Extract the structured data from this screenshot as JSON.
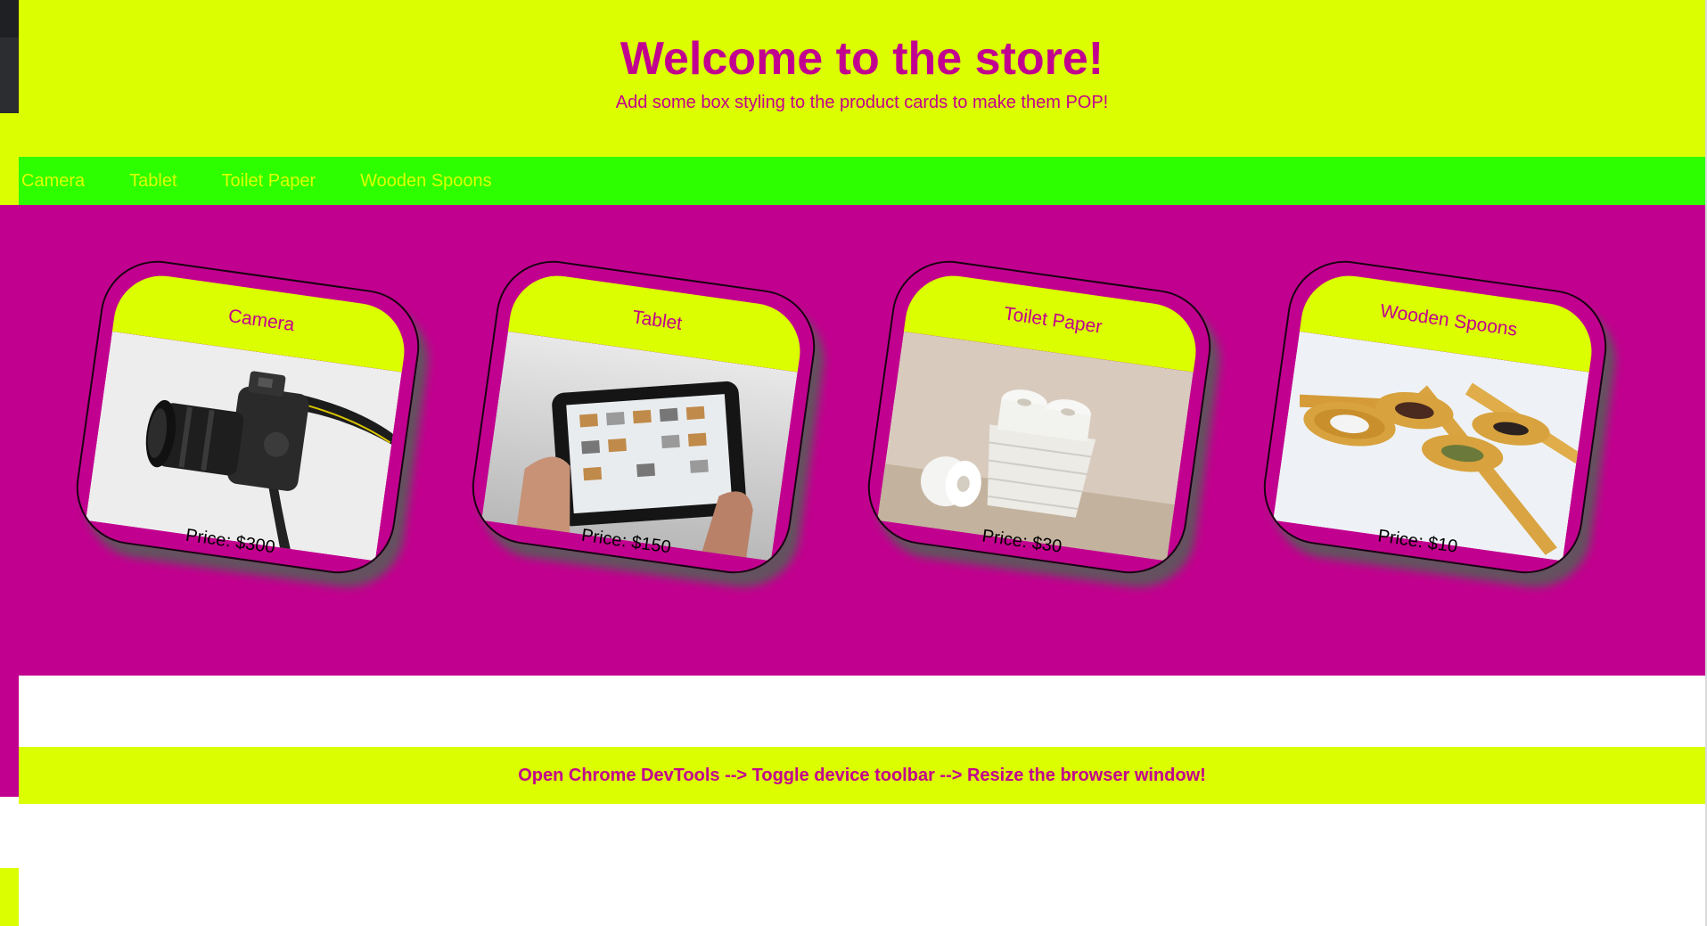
{
  "header": {
    "title": "Welcome to the store!",
    "subtitle": "Add some box styling to the product cards to make them POP!"
  },
  "nav": {
    "items": [
      "Camera",
      "Tablet",
      "Toilet Paper",
      "Wooden Spoons"
    ]
  },
  "products": [
    {
      "name": "Camera",
      "price": "Price: $300",
      "image_icon": "camera-photo"
    },
    {
      "name": "Tablet",
      "price": "Price: $150",
      "image_icon": "tablet-photo"
    },
    {
      "name": "Toilet Paper",
      "price": "Price: $30",
      "image_icon": "toilet-paper-photo"
    },
    {
      "name": "Wooden Spoons",
      "price": "Price: $10",
      "image_icon": "wooden-spoons-photo"
    }
  ],
  "footer": {
    "text": "Open Chrome DevTools --> Toggle device toolbar --> Resize the browser window!"
  },
  "colors": {
    "lime": "#dbff00",
    "green": "#2eff00",
    "magenta": "#c2008f"
  }
}
